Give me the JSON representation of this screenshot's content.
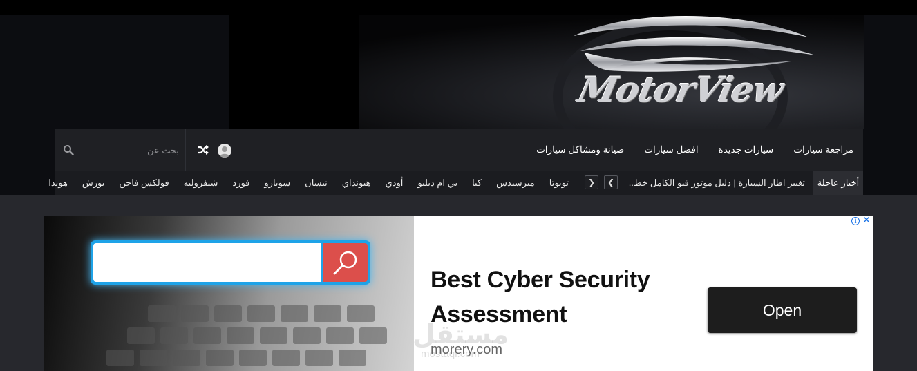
{
  "site": {
    "logo_text": "MotorView"
  },
  "nav": {
    "items": [
      {
        "label": "مراجعة سيارات"
      },
      {
        "label": "سيارات جديدة"
      },
      {
        "label": "افضل سيارات"
      },
      {
        "label": "صيانة ومشاكل سيارات"
      }
    ],
    "search_placeholder": "بحث عن",
    "icons": [
      "search-icon",
      "shuffle-icon",
      "user-avatar"
    ]
  },
  "ticker": {
    "label": "أخبار عاجلة",
    "headline": "تغيير اطار السيارة | دليل موتور فيو الكامل خط..",
    "brands": [
      "تويوتا",
      "ميرسيدس",
      "كيا",
      "بي ام دبليو",
      "أودي",
      "هيونداي",
      "نيسان",
      "سوبارو",
      "فورد",
      "شيفروليه",
      "فولكس فاجن",
      "بورش",
      "هوندا"
    ]
  },
  "ad": {
    "title": "Best Cyber Security Assessment",
    "domain": "morery.com",
    "button_label": "Open",
    "info_icon": "ⓘ",
    "close_icon": "✕"
  },
  "watermark": {
    "text": "مستقل",
    "sub": "mostaql.com"
  },
  "colors": {
    "header_bg": "#0c0d11",
    "nav_bg": "#1f2024",
    "page_bg": "#27282d",
    "ad_search_border": "#1ea3e8",
    "ad_search_button": "#dc4f4b"
  }
}
